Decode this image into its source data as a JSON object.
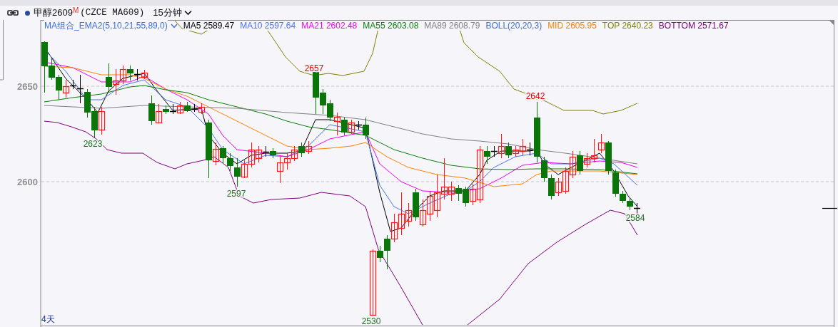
{
  "header": {
    "name": "甲醇2609",
    "badge": "M",
    "code": "(CZCE MA609)",
    "period": "15分钟"
  },
  "legend": [
    {
      "kind": "dropdown",
      "text": "MA组合_EMA2(5,10,21,55,89,0)",
      "color": "#3b6fe0"
    },
    {
      "kind": "value",
      "text": "MA5 2589.47",
      "color": "#000000"
    },
    {
      "kind": "value",
      "text": "MA10 2597.64",
      "color": "#4a73f0"
    },
    {
      "kind": "value",
      "text": "MA21 2602.48",
      "color": "#f000f0"
    },
    {
      "kind": "value",
      "text": "MA55 2603.08",
      "color": "#0b7d0b"
    },
    {
      "kind": "value",
      "text": "MA89 2608.79",
      "color": "#808080"
    },
    {
      "kind": "value",
      "text": "BOLL(20,20,3)",
      "color": "#3b6fe0"
    },
    {
      "kind": "value",
      "text": "MID 2605.95",
      "color": "#ff8000"
    },
    {
      "kind": "value",
      "text": "TOP 2640.23",
      "color": "#808000"
    },
    {
      "kind": "value",
      "text": "BOTTOM 2571.67",
      "color": "#800080"
    }
  ],
  "y_axis": [
    "2650",
    "2600"
  ],
  "price_marks": [
    {
      "text": "2657",
      "color": "#e00000"
    },
    {
      "text": "2623",
      "color": "#1d6e1d"
    },
    {
      "text": "2597",
      "color": "#1d6e1d"
    },
    {
      "text": "2530",
      "color": "#1d6e1d"
    },
    {
      "text": "2642",
      "color": "#e00000"
    },
    {
      "text": "2584",
      "color": "#1d6e1d"
    }
  ],
  "range_label": "4天"
}
